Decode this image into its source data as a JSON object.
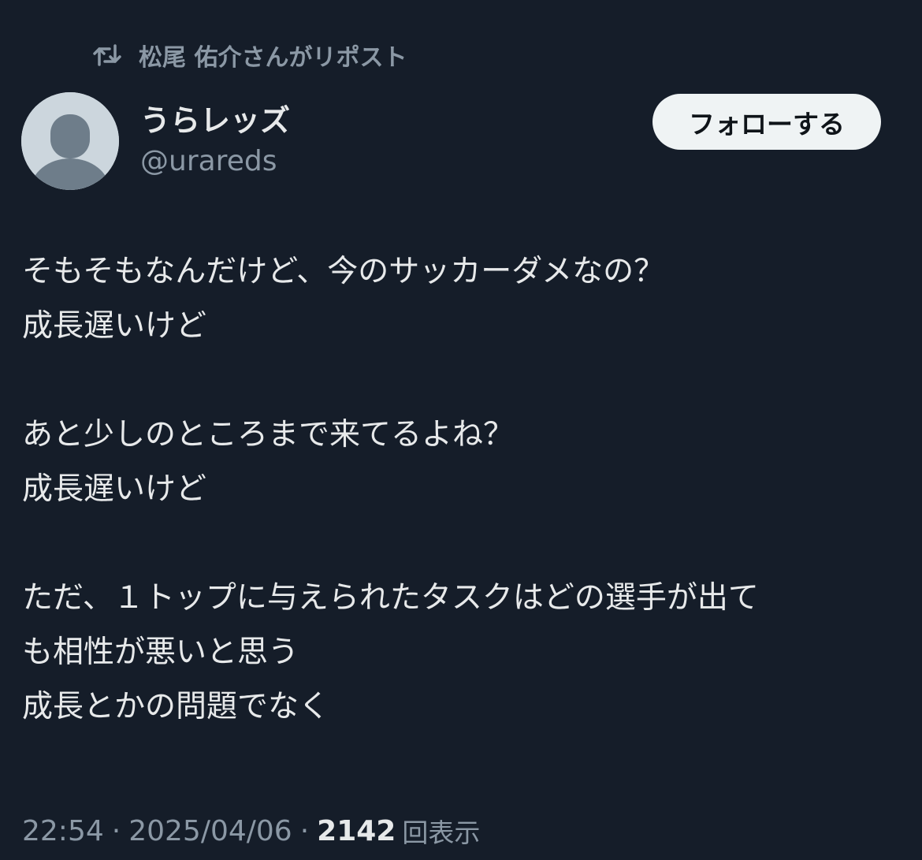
{
  "repost": {
    "icon": "repost-icon",
    "text": "松尾 佑介さんがリポスト"
  },
  "author": {
    "avatar_icon": "default-avatar-icon",
    "display_name": "うらレッズ",
    "handle": "@urareds"
  },
  "follow_button": {
    "label": "フォローする"
  },
  "tweet": {
    "paragraphs": [
      [
        "そもそもなんだけど、今のサッカーダメなの？",
        "成長遅いけど"
      ],
      [
        "あと少しのところまで来てるよね？",
        "成長遅いけど"
      ],
      [
        "ただ、１トップに与えられたタスクはどの選手が出て",
        "も相性が悪いと思う",
        "成長とかの問題でなく"
      ]
    ]
  },
  "meta": {
    "time": "22:54",
    "separator": "·",
    "date": "2025/04/06",
    "views_count": "2142",
    "views_label": "回表示"
  },
  "colors": {
    "background": "#151d29",
    "text_primary": "#e7e9ea",
    "text_secondary": "#8b98a5",
    "button_bg": "#eff3f4",
    "avatar_bg": "#ccd6dd",
    "avatar_fg": "#6e7d8a"
  }
}
